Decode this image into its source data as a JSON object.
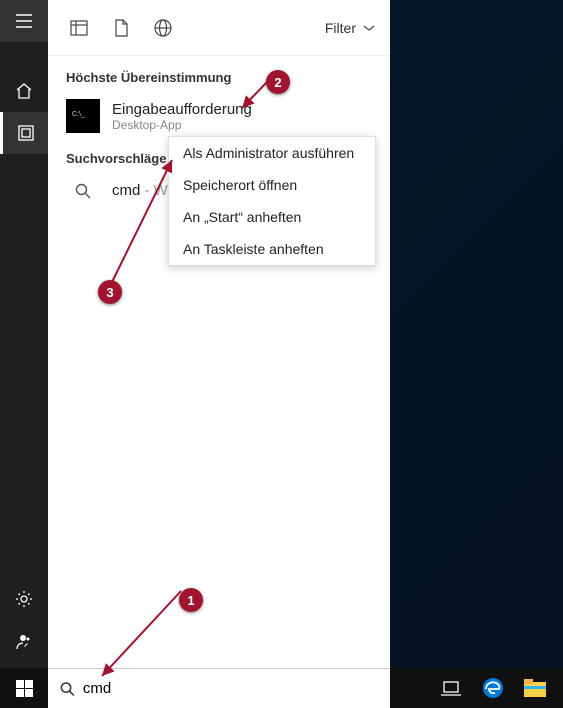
{
  "panel_header": {
    "filter_label": "Filter"
  },
  "sections": {
    "best_match": "Höchste Übereinstimmung",
    "suggestions": "Suchvorschläge"
  },
  "best_result": {
    "title": "Eingabeaufforderung",
    "subtitle": "Desktop-App"
  },
  "suggestion": {
    "term": "cmd",
    "hint": " - Webergebnisse anzeigen"
  },
  "context_menu": {
    "items": [
      "Als Administrator ausführen",
      "Speicherort öffnen",
      "An „Start“ anheften",
      "An Taskleiste anheften"
    ]
  },
  "search_value": "cmd",
  "badges": {
    "b1": "1",
    "b2": "2",
    "b3": "3"
  }
}
